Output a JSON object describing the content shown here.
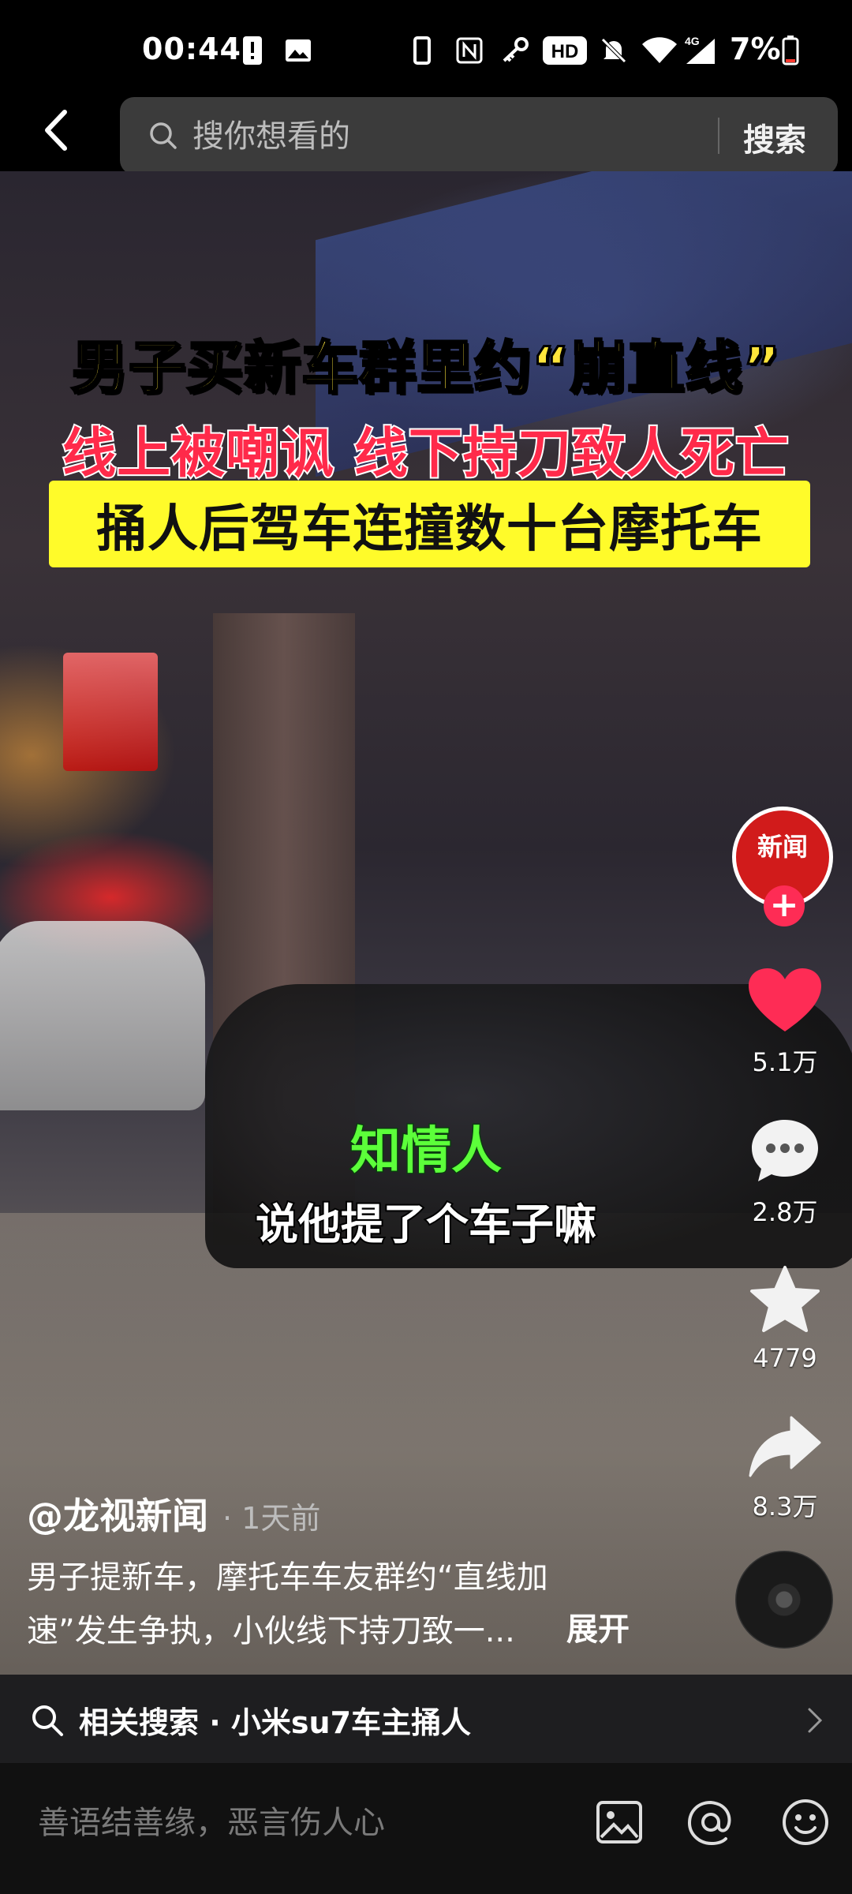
{
  "status_bar": {
    "time": "00:44",
    "network": "4G",
    "battery": "7%"
  },
  "search": {
    "placeholder": "搜你想看的",
    "button": "搜索"
  },
  "video": {
    "headline_1": "男子买新车群里约“崩直线”",
    "headline_2": "线上被嘲讽 线下持刀致人死亡",
    "headline_3": "捅人后驾车连撞数十台摩托车",
    "subtitle_speaker": "知情人",
    "subtitle_text": "说他提了个车子嘛"
  },
  "rail": {
    "avatar_text": "新闻",
    "follow": "+",
    "likes": "5.1万",
    "comments": "2.8万",
    "favorites": "4779",
    "shares": "8.3万"
  },
  "caption": {
    "author": "@龙视新闻",
    "time": "· 1天前",
    "desc": "男子提新车，摩托车车友群约“直线加速”发生争执，小伙线下持刀致一...",
    "expand": "展开"
  },
  "related": {
    "text": "相关搜索 · 小米su7车主捅人"
  },
  "comment": {
    "placeholder": "善语结善缘，恶言伤人心"
  },
  "colors": {
    "accent_red": "#fe2c55",
    "headline_yellow": "#ffe53b",
    "subtitle_green": "#5cff3a"
  }
}
